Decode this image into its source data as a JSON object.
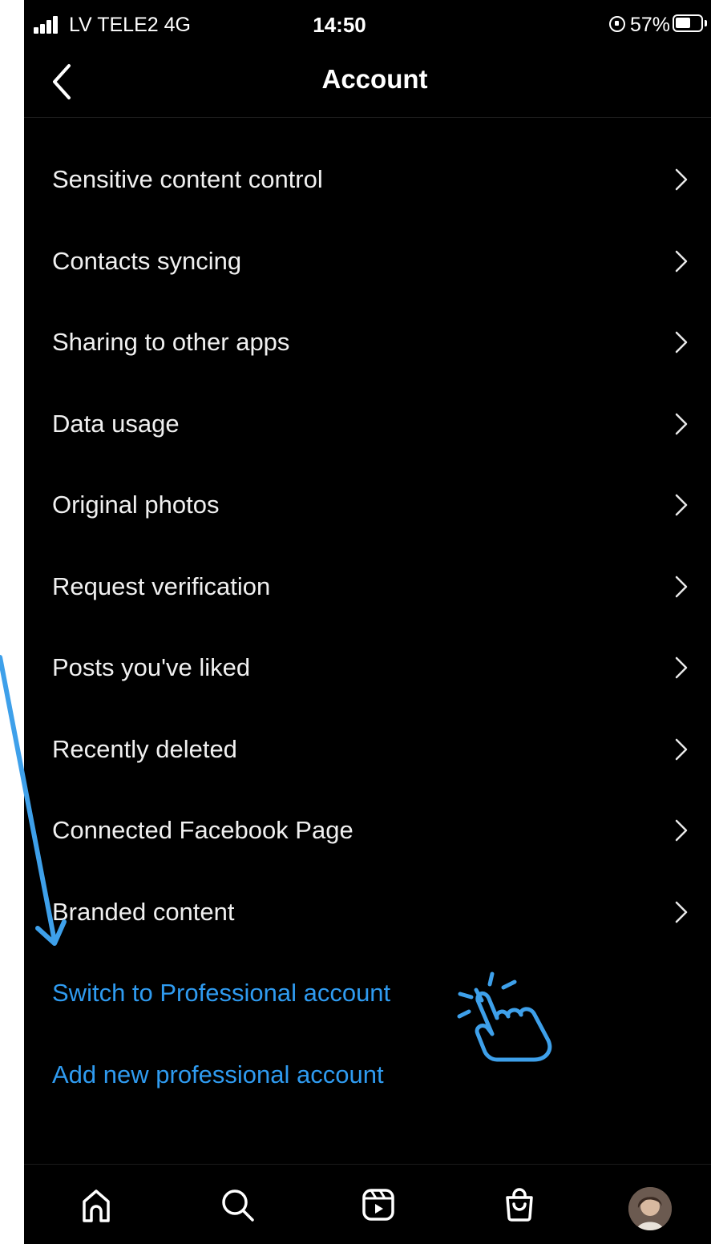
{
  "status_bar": {
    "carrier": "LV TELE2  4G",
    "time": "14:50",
    "battery": "57%"
  },
  "header": {
    "title": "Account",
    "back_icon": "chevron-left-icon"
  },
  "settings": {
    "items": [
      {
        "label": "Sensitive content control"
      },
      {
        "label": "Contacts syncing"
      },
      {
        "label": "Sharing to other apps"
      },
      {
        "label": "Data usage"
      },
      {
        "label": "Original photos"
      },
      {
        "label": "Request verification"
      },
      {
        "label": "Posts you've liked"
      },
      {
        "label": "Recently deleted"
      },
      {
        "label": "Connected Facebook Page"
      },
      {
        "label": "Branded content"
      }
    ],
    "links": [
      {
        "label": "Switch to Professional account"
      },
      {
        "label": "Add new professional account"
      }
    ]
  },
  "bottom_nav": {
    "items": [
      "home-icon",
      "search-icon",
      "reels-icon",
      "shop-icon",
      "profile-avatar"
    ]
  },
  "colors": {
    "background": "#000000",
    "text": "#f5f5f5",
    "link": "#2f9bf0",
    "annotation": "#3ea0ea"
  }
}
